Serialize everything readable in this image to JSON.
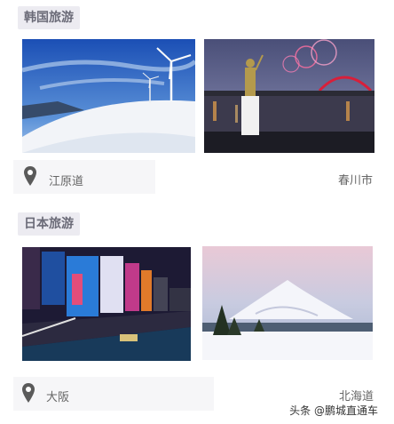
{
  "sections": [
    {
      "title": "韩国旅游",
      "left": {
        "location": "江原道",
        "image": "snowy-hill-wind-turbines"
      },
      "right": {
        "location": "春川市",
        "image": "night-statue-fireworks-bridge"
      }
    },
    {
      "title": "日本旅游",
      "left": {
        "location": "大阪",
        "image": "osaka-dotonbori-night-billboards"
      },
      "right": {
        "location": "北海道",
        "image": "snowy-mount-yotei"
      }
    }
  ],
  "icons": {
    "pin": "location-pin-icon"
  },
  "watermark": "头条 @鹏城直通车"
}
